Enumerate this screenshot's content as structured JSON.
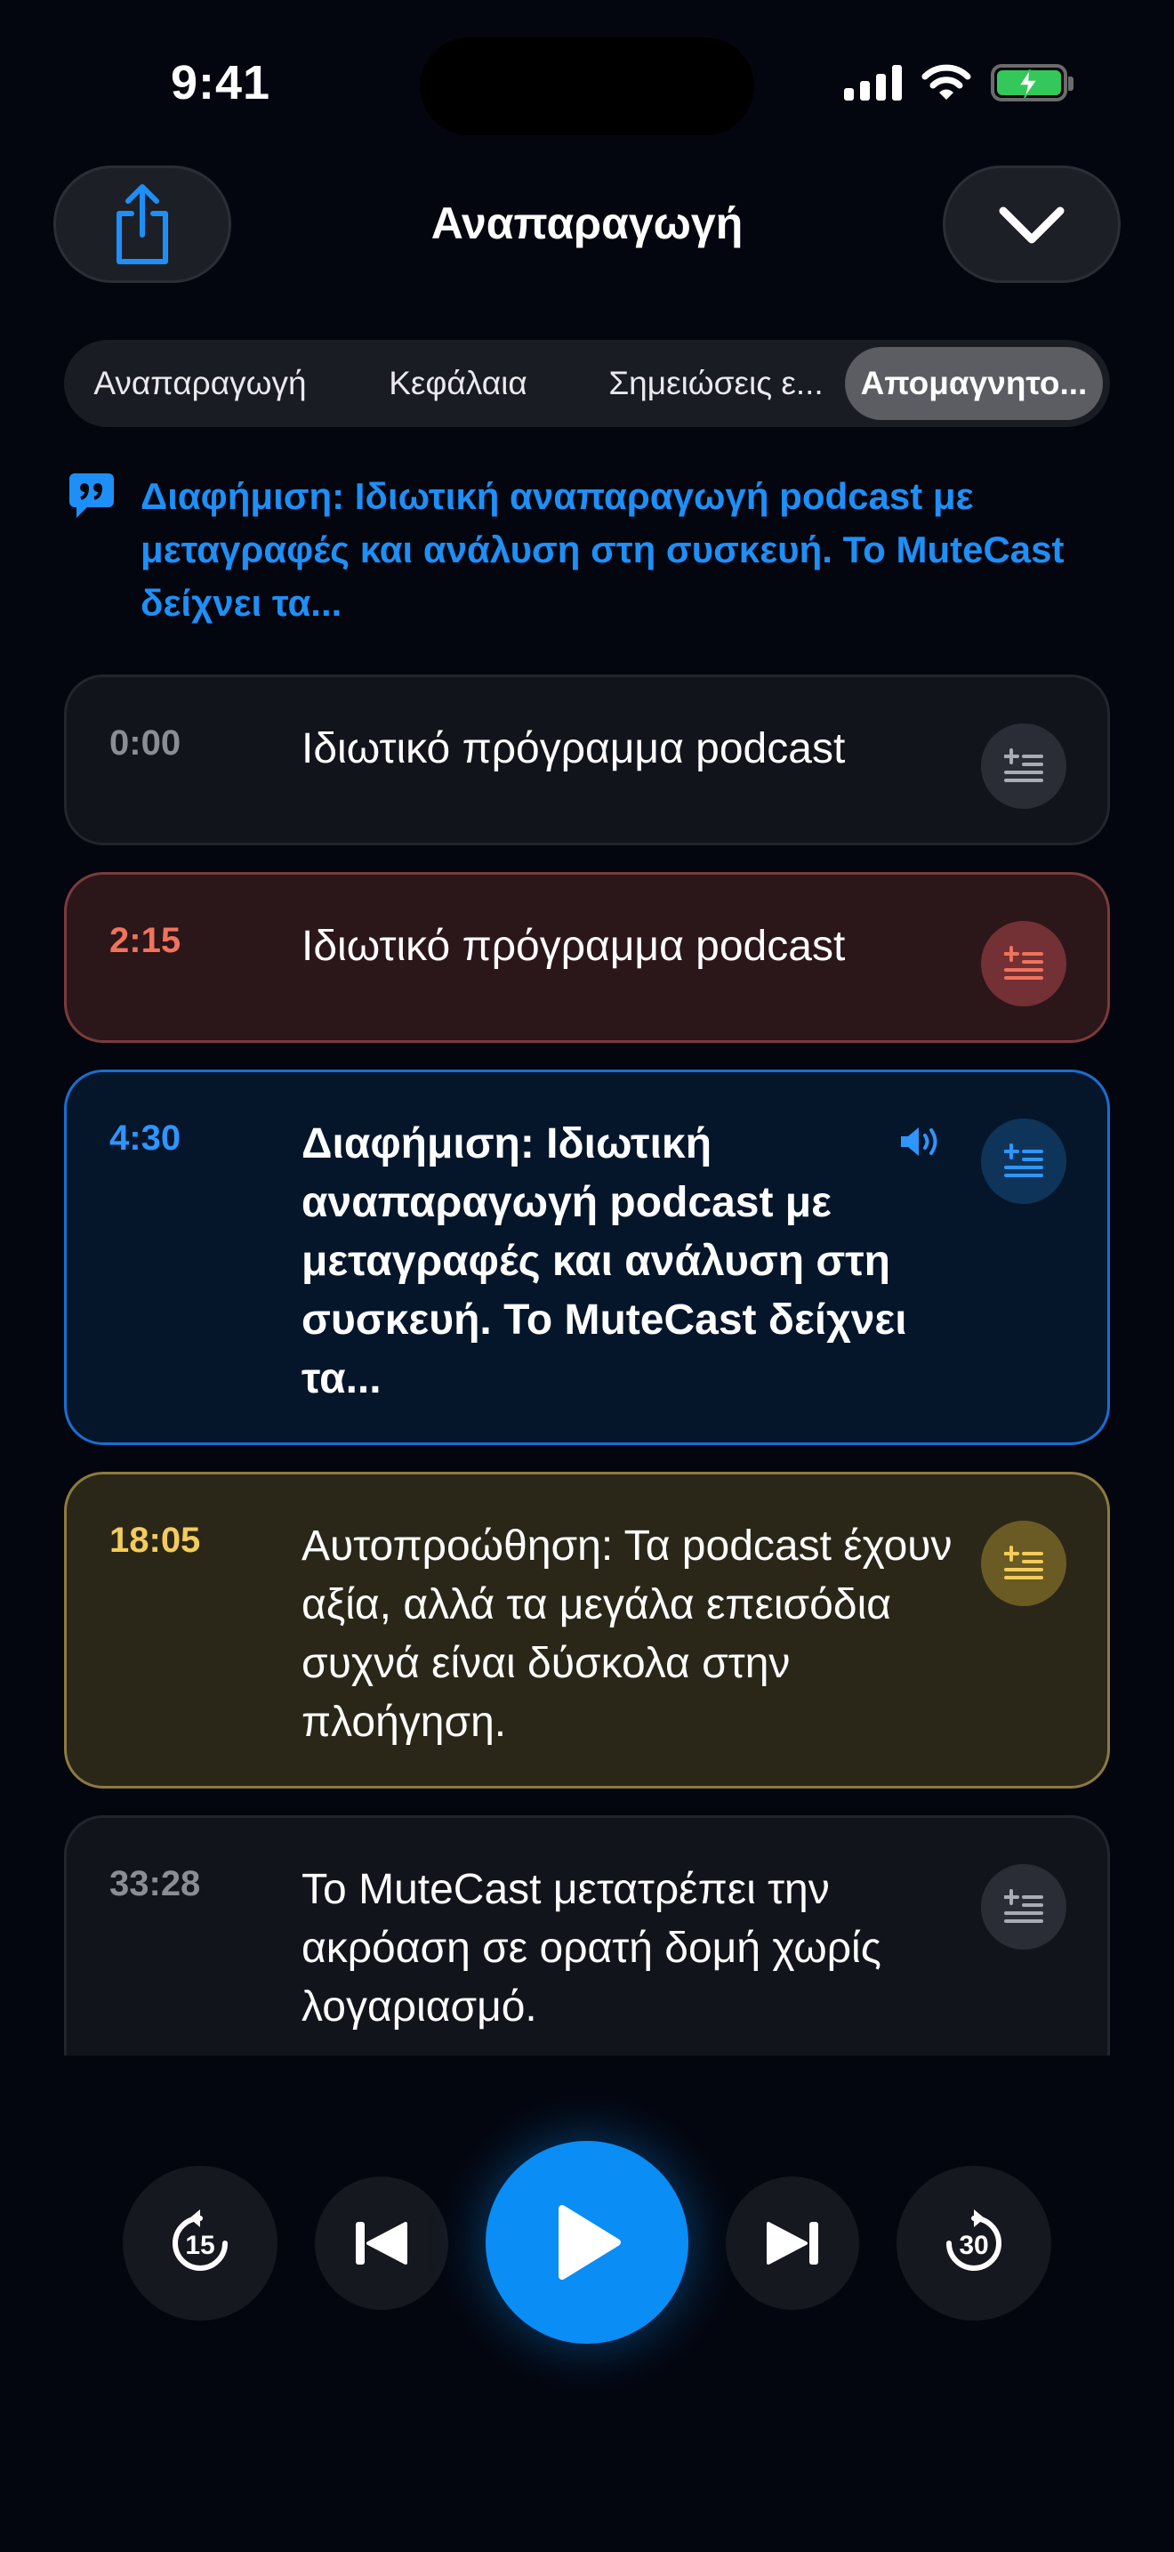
{
  "status": {
    "time": "9:41"
  },
  "header": {
    "title": "Αναπαραγωγή",
    "share_icon": "share-icon",
    "close_icon": "chevron-down-icon"
  },
  "tabs": [
    {
      "label": "Αναπαραγωγή",
      "active": false
    },
    {
      "label": "Κεφάλαια",
      "active": false
    },
    {
      "label": "Σημειώσεις ε...",
      "active": false
    },
    {
      "label": "Απομαγνητο...",
      "active": true
    }
  ],
  "summary": {
    "icon": "quote-bubble-icon",
    "text": "Διαφήμιση: Ιδιωτική αναπαραγωγή podcast με μεταγραφές και ανάλυση στη συσκευή. Το MuteCast δείχνει τα..."
  },
  "segments": [
    {
      "time": "0:00",
      "text": "Ιδιωτικό πρόγραμμα podcast",
      "category": "gray"
    },
    {
      "time": "2:15",
      "text": "Ιδιωτικό πρόγραμμα podcast",
      "category": "red"
    },
    {
      "time": "4:30",
      "text": "Διαφήμιση: Ιδιωτική αναπαραγωγή podcast με μεταγραφές και ανάλυση στη συσκευή. Το MuteCast δείχνει τα...",
      "category": "blue",
      "playing": true
    },
    {
      "time": "18:05",
      "text": "Αυτοπροώθηση: Τα podcast έχουν αξία, αλλά τα μεγάλα επεισόδια συχνά είναι δύσκολα στην πλοήγηση.",
      "category": "yellow"
    },
    {
      "time": "33:28",
      "text": "Το MuteCast μετατρέπει την ακρόαση σε ορατή δομή χωρίς λογαριασμό.",
      "category": "gray"
    }
  ],
  "player": {
    "skip_back_seconds": "15",
    "skip_forward_seconds": "30"
  },
  "colors": {
    "accent": "#0a8df5",
    "red": "#f0735c",
    "blue": "#2f95ff",
    "yellow": "#f4cc58"
  }
}
